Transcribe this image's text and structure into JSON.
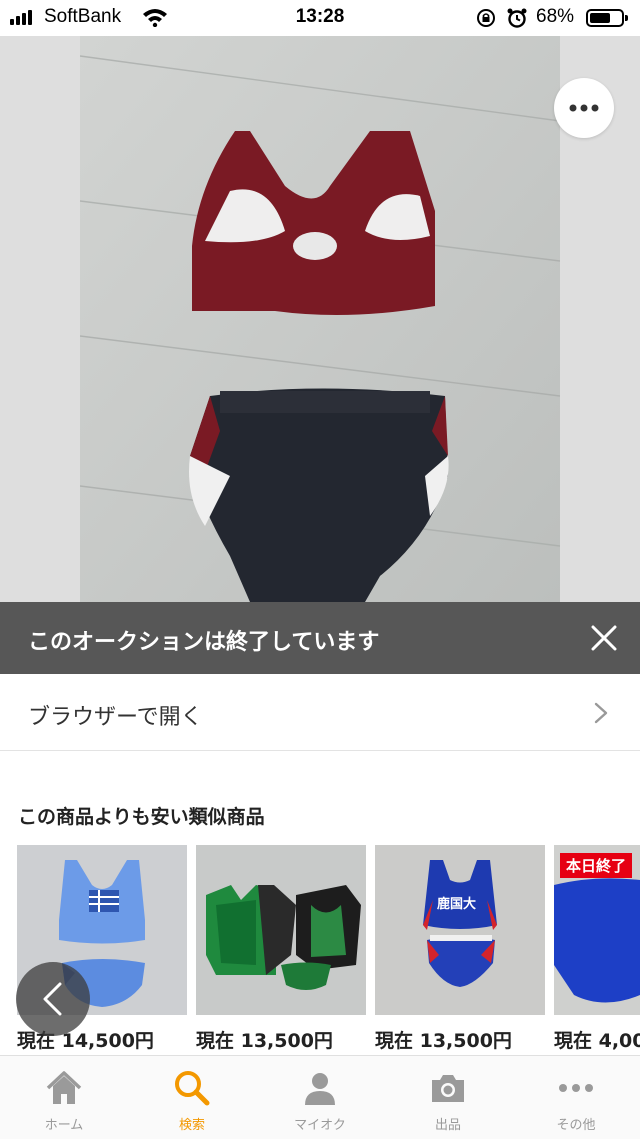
{
  "status_bar": {
    "carrier": "SoftBank",
    "time": "13:28",
    "battery_percent": "68%",
    "battery_level": 0.68
  },
  "photo": {
    "more_icon": "more-dots-icon"
  },
  "ended_banner": {
    "text": "このオークションは終了しています",
    "close_icon": "close-icon"
  },
  "browser": {
    "label": "ブラウザーで開く",
    "chevron_icon": "chevron-right-icon"
  },
  "similar": {
    "title": "この商品よりも安い類似商品",
    "items": [
      {
        "price": "現在 14,500円"
      },
      {
        "price": "現在 13,500円"
      },
      {
        "price": "現在 13,500円",
        "thumb_text": "鹿国大"
      },
      {
        "price": "現在 4,00",
        "badge": "本日終了"
      }
    ]
  },
  "tabs": [
    {
      "label": "ホーム",
      "icon": "home-icon"
    },
    {
      "label": "検索",
      "icon": "search-icon",
      "active": true
    },
    {
      "label": "マイオク",
      "icon": "person-icon"
    },
    {
      "label": "出品",
      "icon": "camera-icon"
    },
    {
      "label": "その他",
      "icon": "more-dots-icon"
    }
  ],
  "colors": {
    "accent": "#f39800",
    "banner": "#575757",
    "badge": "#e60012"
  }
}
